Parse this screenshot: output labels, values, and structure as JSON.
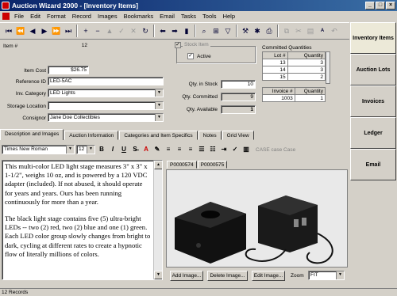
{
  "window": {
    "title": "Auction Wizard 2000 - [Inventory Items]"
  },
  "menu": [
    "File",
    "Edit",
    "Format",
    "Record",
    "Images",
    "Bookmarks",
    "Email",
    "Tasks",
    "Tools",
    "Help"
  ],
  "form": {
    "item_no_label": "Item #",
    "item_no": "12",
    "item_cost_label": "Item Cost",
    "item_cost": "$26.75",
    "reference_id_label": "Reference ID",
    "reference_id": "LED-5AC",
    "inv_category_label": "Inv. Category",
    "inv_category": "LED Lights",
    "storage_location_label": "Storage Location",
    "storage_location": "",
    "consignor_label": "Consignor",
    "consignor": "Jane Doe Collectibles",
    "stock_item_label": "Stock Item",
    "active_label": "Active",
    "qty_in_stock_label": "Qty. in Stock",
    "qty_in_stock": "10",
    "qty_committed_label": "Qty. Committed",
    "qty_committed": "9",
    "qty_available_label": "Qty. Available",
    "qty_available": "1"
  },
  "committed": {
    "title": "Committed Quantities",
    "lot_header": "Lot #",
    "qty_header": "Quantity",
    "lots": [
      {
        "lot": "13",
        "qty": "3"
      },
      {
        "lot": "14",
        "qty": "3"
      },
      {
        "lot": "15",
        "qty": "2"
      }
    ],
    "invoice_header": "Invoice #",
    "invoices": [
      {
        "inv": "1003",
        "qty": "1"
      }
    ]
  },
  "sidebar": [
    {
      "label": "Inventory Items"
    },
    {
      "label": "Auction Lots"
    },
    {
      "label": "Invoices"
    },
    {
      "label": "Ledger"
    },
    {
      "label": "Email"
    }
  ],
  "tabs": [
    "Description and Images",
    "Auction Information",
    "Categories and Item Specifics",
    "Notes",
    "Grid View"
  ],
  "format": {
    "font": "Times New Roman",
    "size": "12",
    "case_label": "CASE case Case"
  },
  "description": [
    "This multi-color LED light stage measures 3\" x 3\" x 1-1/2\", weighs 10 oz, and is powered by a 120 VDC adapter (included).  If not abused, it should operate for years and years.  Ours  has been running continuously for more than a year.",
    "The black light stage contains five (5) ultra-bright LEDs -- two (2) red, two (2) blue and  one (1) green.  Each LED color group slowly changes from bright to dark, cycling at  different rates to create a hypnotic flow of literally millions of colors."
  ],
  "image_tabs": [
    "P0000574",
    "P0000575"
  ],
  "image_buttons": {
    "add": "Add Image...",
    "delete": "Delete Image...",
    "edit": "Edit Image...",
    "zoom_label": "Zoom",
    "zoom": "FIT"
  },
  "status": "12 Records",
  "colors": {
    "title_start": "#0a246a",
    "title_end": "#3a6ea5",
    "face": "#d4d0c8"
  }
}
